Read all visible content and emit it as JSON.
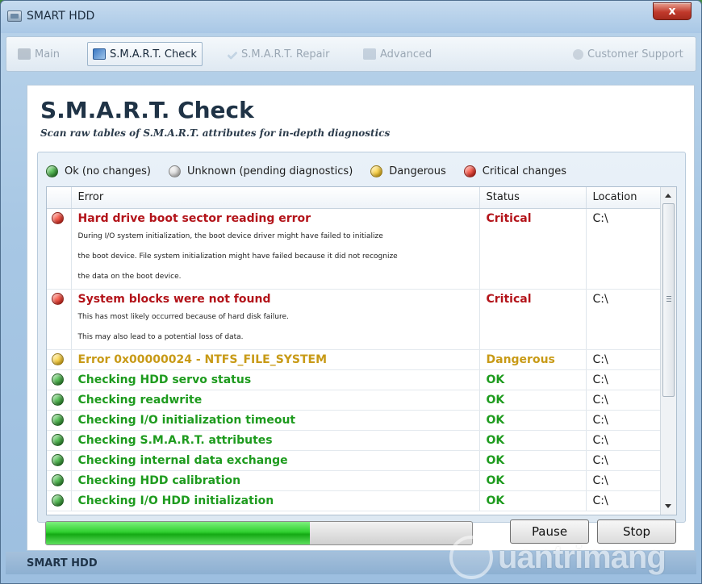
{
  "window": {
    "title": "SMART HDD",
    "close_label": "x"
  },
  "tabs": [
    {
      "label": "Main",
      "icon": "hdd-icon",
      "active": false
    },
    {
      "label": "S.M.A.R.T. Check",
      "icon": "check-monitor-icon",
      "active": true
    },
    {
      "label": "S.M.A.R.T. Repair",
      "icon": "checkmark-icon",
      "active": false
    },
    {
      "label": "Advanced",
      "icon": "advanced-icon",
      "active": false
    }
  ],
  "support_tab": {
    "label": "Customer Support",
    "icon": "people-icon"
  },
  "page": {
    "title": "S.M.A.R.T. Check",
    "subtitle": "Scan raw tables of S.M.A.R.T. attributes for in-depth diagnostics"
  },
  "legend": [
    {
      "label": "Ok (no changes)",
      "kind": "ok"
    },
    {
      "label": "Unknown (pending diagnostics)",
      "kind": "unknown"
    },
    {
      "label": "Dangerous",
      "kind": "danger"
    },
    {
      "label": "Critical changes",
      "kind": "critical"
    }
  ],
  "table": {
    "columns": [
      "Error",
      "Status",
      "Location"
    ],
    "rows": [
      {
        "kind": "critical",
        "title": "Hard drive boot sector reading error",
        "desc": [
          "During I/O system initialization, the boot device driver might have failed to initialize",
          "the boot device. File system initialization might have failed because it did not recognize",
          "the data on the boot device."
        ],
        "status": "Critical",
        "location": "C:\\"
      },
      {
        "kind": "critical",
        "title": "System blocks were not found",
        "desc": [
          "This has most likely occurred because of hard disk failure.",
          "This may also lead to a potential loss of data."
        ],
        "status": "Critical",
        "location": "C:\\"
      },
      {
        "kind": "danger",
        "title": "Error 0x00000024 - NTFS_FILE_SYSTEM",
        "desc": [],
        "status": "Dangerous",
        "location": "C:\\"
      },
      {
        "kind": "ok",
        "title": "Checking HDD servo status",
        "desc": [],
        "status": "OK",
        "location": "C:\\"
      },
      {
        "kind": "ok",
        "title": "Checking readwrite",
        "desc": [],
        "status": "OK",
        "location": "C:\\"
      },
      {
        "kind": "ok",
        "title": "Checking I/O initialization timeout",
        "desc": [],
        "status": "OK",
        "location": "C:\\"
      },
      {
        "kind": "ok",
        "title": "Checking S.M.A.R.T. attributes",
        "desc": [],
        "status": "OK",
        "location": "C:\\"
      },
      {
        "kind": "ok",
        "title": "Checking internal data exchange",
        "desc": [],
        "status": "OK",
        "location": "C:\\"
      },
      {
        "kind": "ok",
        "title": "Checking HDD calibration",
        "desc": [],
        "status": "OK",
        "location": "C:\\"
      },
      {
        "kind": "ok",
        "title": "Checking I/O HDD initialization",
        "desc": [],
        "status": "OK",
        "location": "C:\\"
      }
    ]
  },
  "progress": {
    "fraction": 0.62
  },
  "buttons": {
    "pause": "Pause",
    "stop": "Stop"
  },
  "statusbar": {
    "text": "SMART HDD"
  },
  "watermark": {
    "text": "uantrimang"
  },
  "colors": {
    "critical": "#b3141a",
    "dangerous": "#c89a16",
    "ok": "#1e9b1e",
    "background_green": "#3f8a3f"
  }
}
